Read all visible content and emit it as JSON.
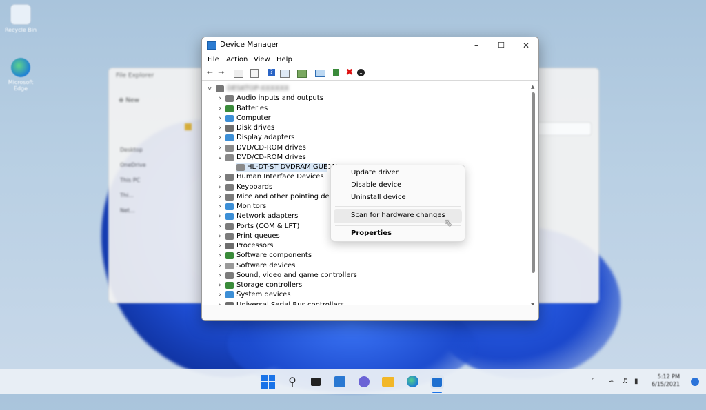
{
  "desktop": {
    "icons": [
      {
        "name": "Recycle Bin"
      },
      {
        "name": "Microsoft Edge"
      }
    ]
  },
  "background_window": {
    "title": "File Explorer",
    "toolbar_new": "New",
    "sidebar": [
      "Desktop",
      "OneDrive",
      "This PC",
      "Thi...",
      "Net..."
    ]
  },
  "device_manager": {
    "title": "Device Manager",
    "menu": [
      "File",
      "Action",
      "View",
      "Help"
    ],
    "toolbar_icons": [
      "back-arrow-icon",
      "forward-arrow-icon",
      "properties-icon",
      "show-hidden-icon",
      "help-icon",
      "device-view-icon",
      "scan-hardware-icon",
      "monitor-icon",
      "update-driver-icon",
      "uninstall-icon",
      "disable-device-icon"
    ],
    "tree": {
      "root": "DESKTOP-XXXXXX",
      "categories": [
        {
          "label": "Audio inputs and outputs",
          "expanded": false,
          "icon": "speaker-icon",
          "color": "#7c7c7c"
        },
        {
          "label": "Batteries",
          "expanded": false,
          "icon": "battery-icon",
          "color": "#3a8b3a"
        },
        {
          "label": "Computer",
          "expanded": false,
          "icon": "computer-icon",
          "color": "#3d8fd6"
        },
        {
          "label": "Disk drives",
          "expanded": false,
          "icon": "disk-icon",
          "color": "#6e6e6e"
        },
        {
          "label": "Display adapters",
          "expanded": false,
          "icon": "display-adapter-icon",
          "color": "#3d8fd6"
        },
        {
          "label": "DVD/CD-ROM drives",
          "expanded": false,
          "icon": "dvd-drive-icon",
          "color": "#8a8a8a"
        },
        {
          "label": "DVD/CD-ROM drives",
          "expanded": true,
          "icon": "dvd-drive-icon",
          "color": "#8a8a8a",
          "children": [
            {
              "label": "HL-DT-ST DVDRAM GUE1N",
              "selected": true
            }
          ]
        },
        {
          "label": "Human Interface Devices",
          "expanded": false,
          "icon": "hid-icon",
          "color": "#7c7c7c"
        },
        {
          "label": "Keyboards",
          "expanded": false,
          "icon": "keyboard-icon",
          "color": "#7c7c7c"
        },
        {
          "label": "Mice and other pointing devices",
          "expanded": false,
          "icon": "mouse-icon",
          "color": "#7c7c7c"
        },
        {
          "label": "Monitors",
          "expanded": false,
          "icon": "monitor-icon",
          "color": "#3d8fd6"
        },
        {
          "label": "Network adapters",
          "expanded": false,
          "icon": "network-icon",
          "color": "#3d8fd6"
        },
        {
          "label": "Ports (COM & LPT)",
          "expanded": false,
          "icon": "port-icon",
          "color": "#7c7c7c"
        },
        {
          "label": "Print queues",
          "expanded": false,
          "icon": "printer-icon",
          "color": "#7c7c7c"
        },
        {
          "label": "Processors",
          "expanded": false,
          "icon": "processor-icon",
          "color": "#6e6e6e"
        },
        {
          "label": "Software components",
          "expanded": false,
          "icon": "software-component-icon",
          "color": "#3a8b3a"
        },
        {
          "label": "Software devices",
          "expanded": false,
          "icon": "software-device-icon",
          "color": "#9a9a9a"
        },
        {
          "label": "Sound, video and game controllers",
          "expanded": false,
          "icon": "sound-icon",
          "color": "#7c7c7c"
        },
        {
          "label": "Storage controllers",
          "expanded": false,
          "icon": "storage-icon",
          "color": "#3a8b3a"
        },
        {
          "label": "System devices",
          "expanded": false,
          "icon": "system-devices-icon",
          "color": "#3d8fd6"
        },
        {
          "label": "Universal Serial Bus controllers",
          "expanded": false,
          "icon": "usb-icon",
          "color": "#6e6e6e"
        }
      ]
    }
  },
  "context_menu": {
    "items": [
      "Update driver",
      "Disable device",
      "Uninstall device",
      "Scan for hardware changes",
      "Properties"
    ],
    "hovered": "Scan for hardware changes"
  },
  "taskbar": {
    "apps": [
      "start-icon",
      "search-icon",
      "task-view-icon",
      "widgets-icon",
      "chat-icon",
      "file-explorer-icon",
      "edge-icon",
      "store-icon"
    ],
    "clock_time": "5:12 PM",
    "clock_date": "6/15/2021"
  }
}
